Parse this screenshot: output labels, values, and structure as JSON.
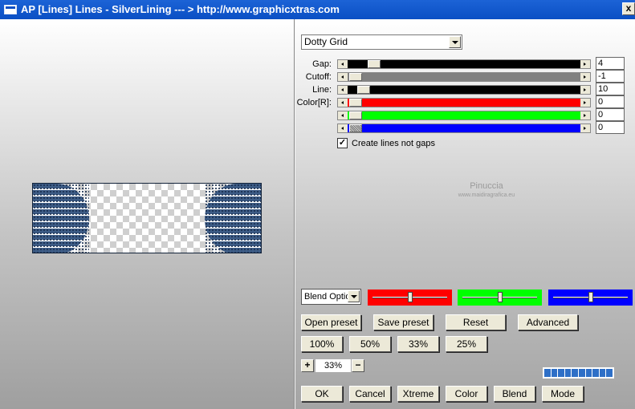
{
  "window": {
    "title": "AP [Lines]  Lines - SilverLining     --- > http://www.graphicxtras.com",
    "close_label": "x"
  },
  "preset": {
    "selected": "Dotty Grid"
  },
  "params": [
    {
      "label": "Gap:",
      "value": "4"
    },
    {
      "label": "Cutoff:",
      "value": "-1"
    },
    {
      "label": "Line:",
      "value": "10"
    },
    {
      "label": "Color[R]:",
      "value": "0"
    },
    {
      "label": "",
      "value": "0"
    },
    {
      "label": "",
      "value": "0"
    }
  ],
  "colors": {
    "red": "#ff0000",
    "green": "#00ff00",
    "blue": "#0000ff",
    "cutoff": "#808080"
  },
  "option": {
    "create_lines_label": "Create lines not gaps",
    "checked_mark": "✓"
  },
  "watermark": {
    "name": "Pinuccia",
    "url": "www.maidiragrafica.eu"
  },
  "blend": {
    "selected": "Blend Optio"
  },
  "buttons": {
    "open_preset": "Open preset",
    "save_preset": "Save preset",
    "reset": "Reset",
    "advanced": "Advanced",
    "zoom_100": "100%",
    "zoom_50": "50%",
    "zoom_33": "33%",
    "zoom_25": "25%",
    "ok": "OK",
    "cancel": "Cancel",
    "xtreme": "Xtreme",
    "color": "Color",
    "blend": "Blend",
    "mode": "Mode"
  },
  "zoom": {
    "plus": "+",
    "minus": "−",
    "value": "33%"
  },
  "progress": {
    "segments": 10,
    "filled": 10
  }
}
